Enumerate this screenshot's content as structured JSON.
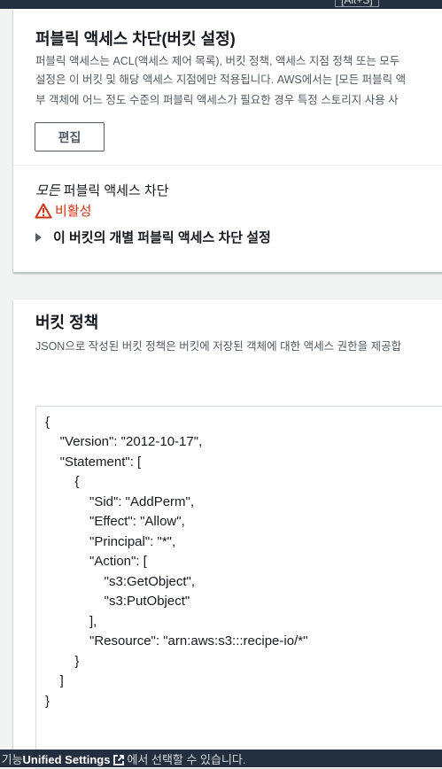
{
  "top": {
    "shortcut_label": "[Alt+S]"
  },
  "public_access": {
    "title": "퍼블릭 액세스 차단(버킷 설정)",
    "desc_lines": [
      "퍼블릭 액세스는 ACL(액세스 제어 목록), 버킷 정책, 액세스 지점 정책 또는 모두",
      "설정은 이 버킷 및 해당 액세스 지점에만 적용됩니다. AWS에서는 [모든 퍼블릭 액",
      "부 객체에 어느 정도 수준의 퍼블릭 액세스가 필요한 경우 특정 스토리지 사용 사"
    ],
    "edit_label": "편집",
    "block_all_em": "모든",
    "block_all_rest": " 퍼블릭 액세스 차단",
    "status": "비활성",
    "status_color": "#d13212",
    "expander_label": "이 버킷의 개별 퍼블릭 액세스 차단 설정"
  },
  "bucket_policy": {
    "title": "버킷 정책",
    "desc": "JSON으로 작성된 버킷 정책은 버킷에 저장된 객체에 대한 액세스 권한을 제공합",
    "code_lines": [
      "{",
      "    \"Version\": \"2012-10-17\",",
      "    \"Statement\": [",
      "        {",
      "            \"Sid\": \"AddPerm\",",
      "            \"Effect\": \"Allow\",",
      "            \"Principal\": \"*\",",
      "            \"Action\": [",
      "                \"s3:GetObject\",",
      "                \"s3:PutObject\"",
      "            ],",
      "            \"Resource\": \"arn:aws:s3:::recipe-io/*\"",
      "        }",
      "    ]",
      "}"
    ]
  },
  "bottom": {
    "prefix": "음 기능",
    "link": "Unified Settings",
    "suffix": "에서 선택할 수 있습니다."
  }
}
